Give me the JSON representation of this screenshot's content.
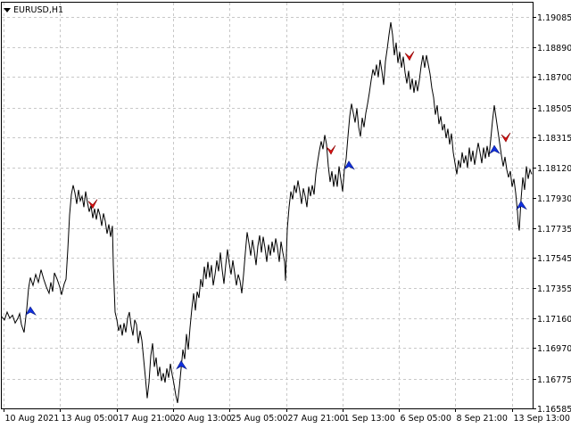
{
  "window": {
    "symbol_title": "EURUSD,H1"
  },
  "colors": {
    "background": "#ffffff",
    "grid": "#c8c8c8",
    "price": "#000000",
    "sell_arrow": "#e01010",
    "buy_arrow": "#1030e0"
  },
  "chart_data": {
    "type": "line",
    "title": "EURUSD,H1",
    "y_ticks": [
      "1.19085",
      "1.18890",
      "1.18700",
      "1.18505",
      "1.18315",
      "1.18120",
      "1.17930",
      "1.17735",
      "1.17545",
      "1.17355",
      "1.17160",
      "1.16970",
      "1.16775",
      "1.16585"
    ],
    "x_ticks": [
      "10 Aug 2021",
      "13 Aug 05:00",
      "17 Aug 21:00",
      "20 Aug 13:00",
      "25 Aug 05:00",
      "27 Aug 21:00",
      "1 Sep 13:00",
      "6 Sep 05:00",
      "8 Sep 21:00",
      "13 Sep 13:00"
    ],
    "ylim": [
      1.16585,
      1.19175
    ],
    "grid": true,
    "series": [
      {
        "values": [
          [
            0,
            1.1717
          ],
          [
            3,
            1.1715
          ],
          [
            6,
            1.172
          ],
          [
            9,
            1.1716
          ],
          [
            12,
            1.1718
          ],
          [
            15,
            1.1713
          ],
          [
            18,
            1.1716
          ],
          [
            20,
            1.1719
          ],
          [
            22,
            1.1712
          ],
          [
            25,
            1.1707
          ],
          [
            28,
            1.1722
          ],
          [
            30,
            1.1735
          ],
          [
            32,
            1.1742
          ],
          [
            35,
            1.1737
          ],
          [
            38,
            1.1744
          ],
          [
            41,
            1.1739
          ],
          [
            44,
            1.1747
          ],
          [
            47,
            1.1741
          ],
          [
            50,
            1.1736
          ],
          [
            53,
            1.1732
          ],
          [
            55,
            1.1739
          ],
          [
            57,
            1.1733
          ],
          [
            59,
            1.1745
          ],
          [
            62,
            1.1741
          ],
          [
            65,
            1.1736
          ],
          [
            67,
            1.1731
          ],
          [
            70,
            1.1738
          ],
          [
            72,
            1.1741
          ],
          [
            74,
            1.176
          ],
          [
            76,
            1.1782
          ],
          [
            78,
            1.1795
          ],
          [
            80,
            1.1801
          ],
          [
            82,
            1.1796
          ],
          [
            84,
            1.1789
          ],
          [
            86,
            1.1798
          ],
          [
            88,
            1.1791
          ],
          [
            90,
            1.1794
          ],
          [
            92,
            1.1787
          ],
          [
            94,
            1.1797
          ],
          [
            96,
            1.179
          ],
          [
            98,
            1.1784
          ],
          [
            100,
            1.1788
          ],
          [
            102,
            1.178
          ],
          [
            104,
            1.1786
          ],
          [
            106,
            1.1779
          ],
          [
            108,
            1.1786
          ],
          [
            110,
            1.1782
          ],
          [
            112,
            1.1775
          ],
          [
            114,
            1.1783
          ],
          [
            116,
            1.1778
          ],
          [
            118,
            1.177
          ],
          [
            120,
            1.1776
          ],
          [
            122,
            1.1768
          ],
          [
            124,
            1.1775
          ],
          [
            125,
            1.175
          ],
          [
            127,
            1.172
          ],
          [
            129,
            1.1715
          ],
          [
            131,
            1.1708
          ],
          [
            133,
            1.1712
          ],
          [
            135,
            1.1705
          ],
          [
            137,
            1.1713
          ],
          [
            139,
            1.1707
          ],
          [
            141,
            1.1716
          ],
          [
            143,
            1.172
          ],
          [
            145,
            1.1711
          ],
          [
            147,
            1.1705
          ],
          [
            149,
            1.1715
          ],
          [
            151,
            1.1712
          ],
          [
            153,
            1.17
          ],
          [
            155,
            1.1708
          ],
          [
            157,
            1.1702
          ],
          [
            159,
            1.169
          ],
          [
            161,
            1.1678
          ],
          [
            163,
            1.1665
          ],
          [
            165,
            1.1675
          ],
          [
            167,
            1.1692
          ],
          [
            169,
            1.17
          ],
          [
            171,
            1.1685
          ],
          [
            173,
            1.1691
          ],
          [
            175,
            1.1679
          ],
          [
            177,
            1.1685
          ],
          [
            179,
            1.1676
          ],
          [
            181,
            1.1681
          ],
          [
            183,
            1.1675
          ],
          [
            185,
            1.1684
          ],
          [
            187,
            1.1678
          ],
          [
            189,
            1.1687
          ],
          [
            191,
            1.168
          ],
          [
            193,
            1.1674
          ],
          [
            195,
            1.1667
          ],
          [
            197,
            1.1662
          ],
          [
            199,
            1.1672
          ],
          [
            201,
            1.1684
          ],
          [
            203,
            1.1696
          ],
          [
            205,
            1.169
          ],
          [
            207,
            1.1706
          ],
          [
            209,
            1.1696
          ],
          [
            211,
            1.171
          ],
          [
            213,
            1.1722
          ],
          [
            215,
            1.1732
          ],
          [
            217,
            1.1721
          ],
          [
            219,
            1.1733
          ],
          [
            221,
            1.1729
          ],
          [
            223,
            1.1741
          ],
          [
            225,
            1.1736
          ],
          [
            227,
            1.1749
          ],
          [
            229,
            1.1741
          ],
          [
            231,
            1.1752
          ],
          [
            233,
            1.1742
          ],
          [
            235,
            1.175
          ],
          [
            237,
            1.1737
          ],
          [
            239,
            1.1744
          ],
          [
            241,
            1.1753
          ],
          [
            243,
            1.1746
          ],
          [
            245,
            1.1758
          ],
          [
            247,
            1.1747
          ],
          [
            249,
            1.1738
          ],
          [
            251,
            1.175
          ],
          [
            253,
            1.176
          ],
          [
            255,
            1.1751
          ],
          [
            257,
            1.1744
          ],
          [
            259,
            1.1753
          ],
          [
            261,
            1.1745
          ],
          [
            263,
            1.1737
          ],
          [
            265,
            1.1744
          ],
          [
            267,
            1.174
          ],
          [
            269,
            1.1732
          ],
          [
            271,
            1.1744
          ],
          [
            273,
            1.1758
          ],
          [
            275,
            1.1771
          ],
          [
            277,
            1.1764
          ],
          [
            279,
            1.1756
          ],
          [
            281,
            1.1766
          ],
          [
            283,
            1.1759
          ],
          [
            285,
            1.175
          ],
          [
            287,
            1.1762
          ],
          [
            289,
            1.1769
          ],
          [
            291,
            1.1758
          ],
          [
            293,
            1.1768
          ],
          [
            295,
            1.1761
          ],
          [
            297,
            1.1752
          ],
          [
            299,
            1.1763
          ],
          [
            301,
            1.1756
          ],
          [
            303,
            1.1765
          ],
          [
            305,
            1.1758
          ],
          [
            307,
            1.1767
          ],
          [
            309,
            1.1761
          ],
          [
            311,
            1.1752
          ],
          [
            313,
            1.1765
          ],
          [
            315,
            1.1758
          ],
          [
            317,
            1.1752
          ],
          [
            318,
            1.174
          ],
          [
            320,
            1.1773
          ],
          [
            322,
            1.1787
          ],
          [
            324,
            1.1797
          ],
          [
            326,
            1.1792
          ],
          [
            328,
            1.1801
          ],
          [
            330,
            1.1796
          ],
          [
            332,
            1.1804
          ],
          [
            334,
            1.1797
          ],
          [
            336,
            1.1789
          ],
          [
            338,
            1.1799
          ],
          [
            340,
            1.1794
          ],
          [
            342,
            1.1787
          ],
          [
            344,
            1.18
          ],
          [
            346,
            1.1794
          ],
          [
            348,
            1.1801
          ],
          [
            350,
            1.1795
          ],
          [
            352,
            1.1808
          ],
          [
            354,
            1.1816
          ],
          [
            356,
            1.1823
          ],
          [
            358,
            1.1829
          ],
          [
            360,
            1.1824
          ],
          [
            362,
            1.1833
          ],
          [
            364,
            1.1827
          ],
          [
            366,
            1.1813
          ],
          [
            368,
            1.1803
          ],
          [
            370,
            1.181
          ],
          [
            372,
            1.18
          ],
          [
            374,
            1.1808
          ],
          [
            376,
            1.18
          ],
          [
            378,
            1.1813
          ],
          [
            380,
            1.1805
          ],
          [
            382,
            1.1797
          ],
          [
            384,
            1.1811
          ],
          [
            386,
            1.1818
          ],
          [
            388,
            1.1832
          ],
          [
            390,
            1.1845
          ],
          [
            392,
            1.1853
          ],
          [
            394,
            1.1847
          ],
          [
            396,
            1.1841
          ],
          [
            398,
            1.185
          ],
          [
            400,
            1.1838
          ],
          [
            402,
            1.1832
          ],
          [
            404,
            1.1844
          ],
          [
            406,
            1.1838
          ],
          [
            408,
            1.1847
          ],
          [
            410,
            1.1853
          ],
          [
            412,
            1.186
          ],
          [
            414,
            1.1868
          ],
          [
            416,
            1.1875
          ],
          [
            418,
            1.1871
          ],
          [
            420,
            1.1878
          ],
          [
            422,
            1.187
          ],
          [
            424,
            1.1881
          ],
          [
            426,
            1.1874
          ],
          [
            428,
            1.1865
          ],
          [
            430,
            1.188
          ],
          [
            432,
            1.1888
          ],
          [
            434,
            1.1897
          ],
          [
            436,
            1.1905
          ],
          [
            438,
            1.1897
          ],
          [
            440,
            1.1884
          ],
          [
            442,
            1.1892
          ],
          [
            444,
            1.1879
          ],
          [
            446,
            1.1886
          ],
          [
            448,
            1.1876
          ],
          [
            450,
            1.1883
          ],
          [
            452,
            1.1873
          ],
          [
            454,
            1.1866
          ],
          [
            456,
            1.1874
          ],
          [
            458,
            1.1862
          ],
          [
            460,
            1.1869
          ],
          [
            462,
            1.186
          ],
          [
            464,
            1.1868
          ],
          [
            466,
            1.1861
          ],
          [
            468,
            1.1868
          ],
          [
            470,
            1.1877
          ],
          [
            472,
            1.1884
          ],
          [
            474,
            1.1876
          ],
          [
            476,
            1.1884
          ],
          [
            478,
            1.1878
          ],
          [
            480,
            1.1872
          ],
          [
            482,
            1.1863
          ],
          [
            484,
            1.1857
          ],
          [
            486,
            1.1846
          ],
          [
            488,
            1.1852
          ],
          [
            490,
            1.184
          ],
          [
            492,
            1.1845
          ],
          [
            494,
            1.1836
          ],
          [
            496,
            1.184
          ],
          [
            498,
            1.1831
          ],
          [
            500,
            1.1837
          ],
          [
            502,
            1.1827
          ],
          [
            504,
            1.1834
          ],
          [
            506,
            1.1822
          ],
          [
            508,
            1.1815
          ],
          [
            510,
            1.1808
          ],
          [
            512,
            1.1817
          ],
          [
            514,
            1.1812
          ],
          [
            516,
            1.1822
          ],
          [
            518,
            1.1815
          ],
          [
            520,
            1.182
          ],
          [
            522,
            1.1812
          ],
          [
            524,
            1.1825
          ],
          [
            526,
            1.1816
          ],
          [
            528,
            1.1823
          ],
          [
            530,
            1.1814
          ],
          [
            532,
            1.1821
          ],
          [
            534,
            1.1828
          ],
          [
            536,
            1.1822
          ],
          [
            538,
            1.1815
          ],
          [
            540,
            1.1825
          ],
          [
            542,
            1.1818
          ],
          [
            544,
            1.1826
          ],
          [
            546,
            1.1819
          ],
          [
            548,
            1.183
          ],
          [
            550,
            1.1842
          ],
          [
            552,
            1.1852
          ],
          [
            554,
            1.1844
          ],
          [
            556,
            1.1836
          ],
          [
            558,
            1.1828
          ],
          [
            560,
            1.182
          ],
          [
            562,
            1.1813
          ],
          [
            564,
            1.1819
          ],
          [
            566,
            1.1811
          ],
          [
            568,
            1.1806
          ],
          [
            570,
            1.181
          ],
          [
            572,
            1.18
          ],
          [
            574,
            1.1805
          ],
          [
            576,
            1.1796
          ],
          [
            578,
            1.1784
          ],
          [
            579,
            1.1776
          ],
          [
            580,
            1.1772
          ],
          [
            582,
            1.1792
          ],
          [
            584,
            1.1806
          ],
          [
            586,
            1.1798
          ],
          [
            588,
            1.1813
          ],
          [
            590,
            1.1805
          ],
          [
            592,
            1.1811
          ],
          [
            594,
            1.1808
          ]
        ]
      }
    ],
    "signals": [
      {
        "type": "sell",
        "x": 101,
        "y": 1.17885
      },
      {
        "type": "buy",
        "x": 32,
        "y": 1.17205
      },
      {
        "type": "buy",
        "x": 201,
        "y": 1.1686
      },
      {
        "type": "sell",
        "x": 368,
        "y": 1.1823
      },
      {
        "type": "buy",
        "x": 389,
        "y": 1.18135
      },
      {
        "type": "sell",
        "x": 456,
        "y": 1.1883
      },
      {
        "type": "buy",
        "x": 552,
        "y": 1.18235
      },
      {
        "type": "sell",
        "x": 564,
        "y": 1.1831
      },
      {
        "type": "buy",
        "x": 582,
        "y": 1.1788
      }
    ]
  }
}
